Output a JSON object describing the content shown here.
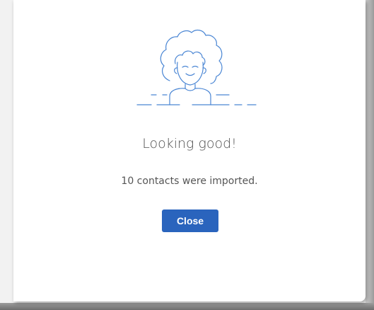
{
  "dialog": {
    "illustration_icon": "smiling-person-illustration",
    "title": "Looking good!",
    "message": "10 contacts were imported.",
    "close_label": "Close"
  },
  "colors": {
    "accent": "#2a64bd",
    "illustration_stroke": "#4a86d4",
    "title_text": "#505050",
    "message_text": "#555555",
    "background": "#ffffff"
  }
}
